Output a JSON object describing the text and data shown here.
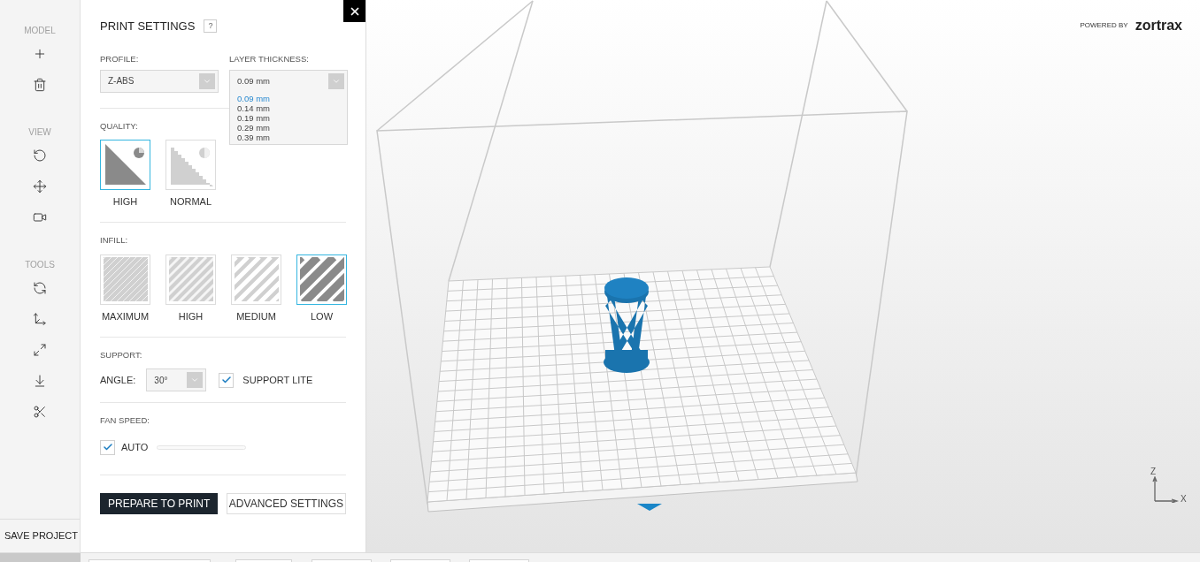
{
  "sidebar": {
    "sections": [
      {
        "title": "MODEL"
      },
      {
        "title": "VIEW"
      },
      {
        "title": "TOOLS"
      }
    ],
    "save_button": "SAVE PROJECT"
  },
  "panel": {
    "title": "PRINT SETTINGS",
    "help": "?",
    "profile": {
      "label": "PROFILE:",
      "value": "Z-ABS"
    },
    "layer_thickness": {
      "label": "LAYER THICKNESS:",
      "value": "0.09 mm",
      "expanded": true,
      "options": [
        {
          "label": "0.09 mm",
          "selected": true
        },
        {
          "label": "0.14 mm",
          "selected": false
        },
        {
          "label": "0.19 mm",
          "selected": false
        },
        {
          "label": "0.29 mm",
          "selected": false
        },
        {
          "label": "0.39 mm",
          "selected": false
        }
      ]
    },
    "quality": {
      "label": "QUALITY:",
      "options": [
        {
          "label": "HIGH",
          "kind": "high",
          "selected": true
        },
        {
          "label": "NORMAL",
          "kind": "normal",
          "selected": false
        }
      ]
    },
    "infill": {
      "label": "INFILL:",
      "options": [
        {
          "label": "MAXIMUM",
          "kind": "maximum",
          "selected": false
        },
        {
          "label": "HIGH",
          "kind": "high",
          "selected": false
        },
        {
          "label": "MEDIUM",
          "kind": "medium",
          "selected": false
        },
        {
          "label": "LOW",
          "kind": "low",
          "selected": true
        }
      ]
    },
    "support": {
      "label": "SUPPORT:",
      "angle_label": "ANGLE:",
      "angle": "30°",
      "support_lite": {
        "label": "SUPPORT LITE",
        "checked": true
      }
    },
    "fan_speed": {
      "label": "FAN SPEED:",
      "auto": {
        "label": "AUTO",
        "checked": true
      },
      "level": 0
    },
    "buttons": {
      "prepare": "PREPARE TO PRINT",
      "advanced": "ADVANCED SETTINGS"
    }
  },
  "viewport": {
    "powered_by": "POWERED BY",
    "brand": "zortrax",
    "axes": {
      "z": "Z",
      "x": "X"
    }
  }
}
